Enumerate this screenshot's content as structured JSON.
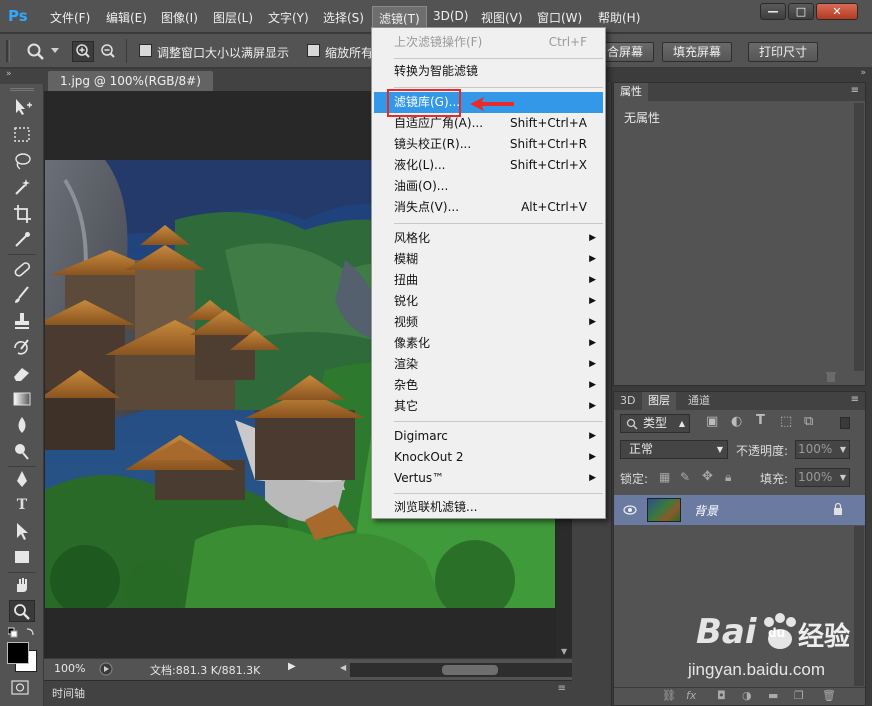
{
  "app": {
    "logo": "Ps"
  },
  "menubar": {
    "items": [
      "文件(F)",
      "编辑(E)",
      "图像(I)",
      "图层(L)",
      "文字(Y)",
      "选择(S)",
      "滤镜(T)",
      "3D(D)",
      "视图(V)",
      "窗口(W)",
      "帮助(H)"
    ],
    "active": "滤镜(T)"
  },
  "window_controls": {
    "minimize": "—",
    "maximize": "□",
    "close": "✕"
  },
  "options_bar": {
    "resize_windows_label": "调整窗口大小以满屏显示",
    "zoom_all_label": "缩放所有",
    "fit_screen_label": "合屏幕",
    "fill_screen_label": "填充屏幕",
    "print_size_label": "打印尺寸"
  },
  "document": {
    "tab_title": "1.jpg @ 100%(RGB/8#)",
    "zoom": "100%",
    "doc_info": "文档:881.3 K/881.3K",
    "timeline_label": "时间轴"
  },
  "filter_menu": {
    "items": [
      {
        "label": "上次滤镜操作(F)",
        "shortcut": "Ctrl+F",
        "disabled": true
      },
      {
        "label": "转换为智能滤镜",
        "shortcut": ""
      },
      {
        "label": "滤镜库(G)...",
        "shortcut": "",
        "highlighted": true
      },
      {
        "label": "自适应广角(A)...",
        "shortcut": "Shift+Ctrl+A"
      },
      {
        "label": "镜头校正(R)...",
        "shortcut": "Shift+Ctrl+R"
      },
      {
        "label": "液化(L)...",
        "shortcut": "Shift+Ctrl+X"
      },
      {
        "label": "油画(O)...",
        "shortcut": ""
      },
      {
        "label": "消失点(V)...",
        "shortcut": "Alt+Ctrl+V"
      },
      {
        "label": "风格化",
        "submenu": true
      },
      {
        "label": "模糊",
        "submenu": true
      },
      {
        "label": "扭曲",
        "submenu": true
      },
      {
        "label": "锐化",
        "submenu": true
      },
      {
        "label": "视频",
        "submenu": true
      },
      {
        "label": "像素化",
        "submenu": true
      },
      {
        "label": "渲染",
        "submenu": true
      },
      {
        "label": "杂色",
        "submenu": true
      },
      {
        "label": "其它",
        "submenu": true
      },
      {
        "label": "Digimarc",
        "submenu": true
      },
      {
        "label": "KnockOut 2",
        "submenu": true
      },
      {
        "label": "Vertus™",
        "submenu": true
      },
      {
        "label": "浏览联机滤镜...",
        "shortcut": ""
      }
    ]
  },
  "properties_panel": {
    "tab": "属性",
    "content": "无属性"
  },
  "layers_panel": {
    "tabs": [
      "3D",
      "图层",
      "通道"
    ],
    "active_tab": "图层",
    "kind_filter": "类型",
    "blend_mode": "正常",
    "opacity_label": "不透明度:",
    "opacity_value": "100%",
    "lock_label": "锁定:",
    "fill_label": "填充:",
    "fill_value": "100%",
    "layers": [
      {
        "name": "背景",
        "locked": true,
        "visible": true
      }
    ]
  },
  "watermark": {
    "brand": "Bai",
    "brand_suffix": "du",
    "product": "经验",
    "url": "jingyan.baidu.com"
  },
  "colors": {
    "accent": "#3498e8",
    "annotation": "#e82a2a",
    "panel_bg": "#535353",
    "canvas_bg": "#282828"
  }
}
